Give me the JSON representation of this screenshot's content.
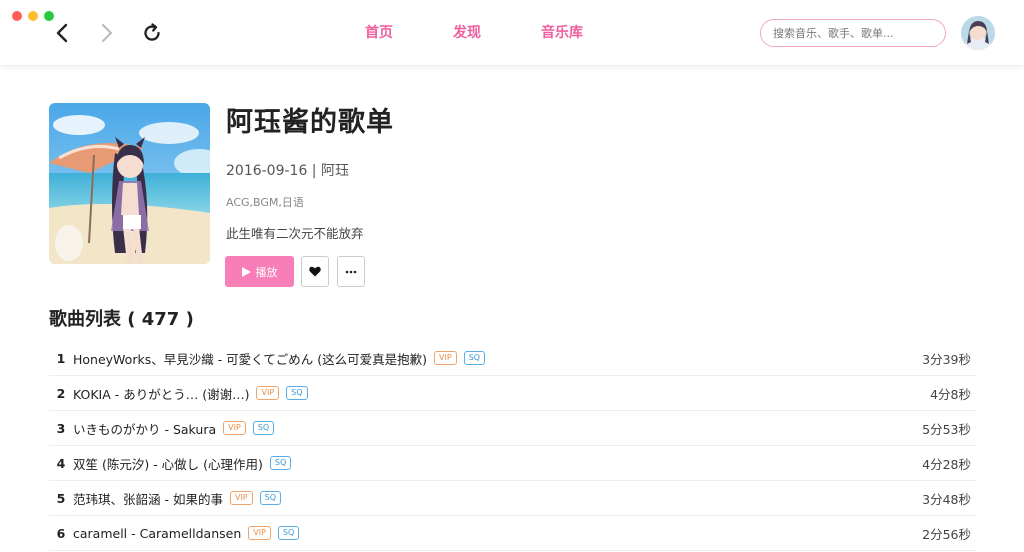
{
  "nav": {
    "links": [
      "首页",
      "发现",
      "音乐库"
    ],
    "search_placeholder": "搜索音乐、歌手、歌单..."
  },
  "playlist": {
    "title": "阿珏酱的歌单",
    "meta": "2016-09-16 | 阿珏",
    "tags": "ACG,BGM,日语",
    "description": "此生唯有二次元不能放弃",
    "play_label": "播放",
    "list_heading": "歌曲列表 ( 477 )"
  },
  "songs": [
    {
      "num": "1",
      "name": "HoneyWorks、早見沙織 - 可愛くてごめん (这么可爱真是抱歉)",
      "vip": "VIP",
      "sq": "SQ",
      "duration": "3分39秒"
    },
    {
      "num": "2",
      "name": "KOKIA - ありがとう… (谢谢…)",
      "vip": "VIP",
      "sq": "SQ",
      "duration": "4分8秒"
    },
    {
      "num": "3",
      "name": "いきものがかり - Sakura",
      "vip": "VIP",
      "sq": "SQ",
      "duration": "5分53秒"
    },
    {
      "num": "4",
      "name": "双笙 (陈元汐) - 心做し (心理作用)",
      "vip": "",
      "sq": "SQ",
      "duration": "4分28秒"
    },
    {
      "num": "5",
      "name": "范玮琪、张韶涵 - 如果的事",
      "vip": "VIP",
      "sq": "SQ",
      "duration": "3分48秒"
    },
    {
      "num": "6",
      "name": "caramell - Caramelldansen",
      "vip": "VIP",
      "sq": "SQ",
      "duration": "2分56秒"
    }
  ],
  "colors": {
    "accent": "#f77eb6",
    "nav_link": "#ee5fa0",
    "vip": "#e98e47",
    "sq": "#3a97d6"
  },
  "icons": [
    "back-icon",
    "forward-icon",
    "reload-icon",
    "play-icon",
    "heart-icon",
    "more-icon"
  ]
}
